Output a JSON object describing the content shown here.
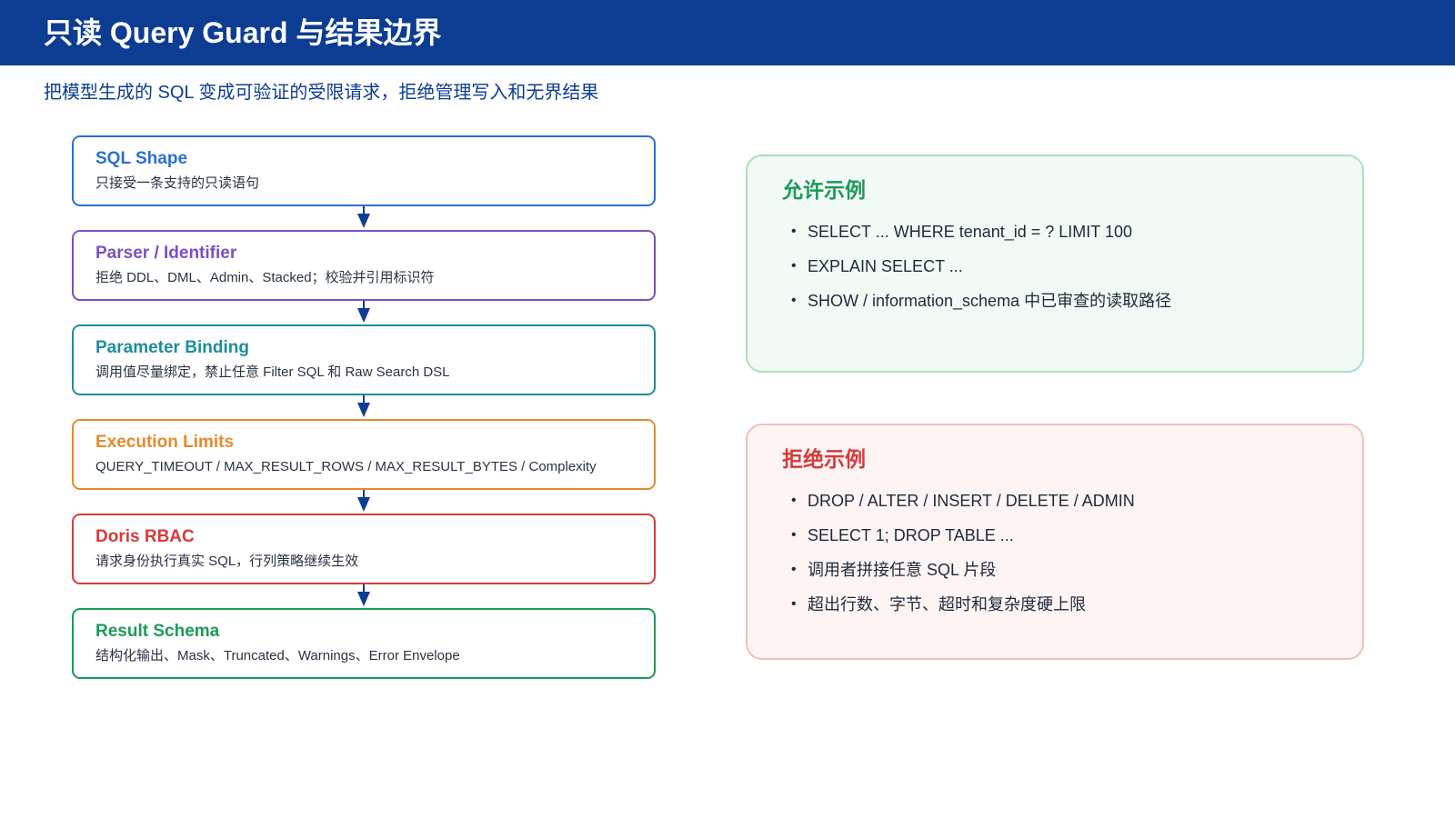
{
  "header": {
    "title": "只读 Query Guard 与结果边界",
    "subtitle": "把模型生成的 SQL 变成可验证的受限请求，拒绝管理写入和无界结果",
    "background": "#0d3d92"
  },
  "flow": {
    "steps": [
      {
        "title": "SQL Shape",
        "desc": "只接受一条支持的只读语句",
        "color": "#2a6fd6"
      },
      {
        "title": "Parser / Identifier",
        "desc": "拒绝 DDL、DML、Admin、Stacked；校验并引用标识符",
        "color": "#7b4fc4"
      },
      {
        "title": "Parameter Binding",
        "desc": "调用值尽量绑定，禁止任意 Filter SQL 和 Raw Search DSL",
        "color": "#1f8c9c"
      },
      {
        "title": "Execution Limits",
        "desc": "QUERY_TIMEOUT / MAX_RESULT_ROWS / MAX_RESULT_BYTES / Complexity",
        "color": "#e58a2c"
      },
      {
        "title": "Doris RBAC",
        "desc": "请求身份执行真实 SQL，行列策略继续生效",
        "color": "#d63b3b"
      },
      {
        "title": "Result Schema",
        "desc": "结构化输出、Mask、Truncated、Warnings、Error Envelope",
        "color": "#1c9a5a"
      }
    ],
    "arrow_color": "#0d3d92",
    "arrow_icon": "arrow-down-icon"
  },
  "allowed": {
    "title": "允许示例",
    "items": [
      "SELECT ... WHERE tenant_id = ? LIMIT 100",
      "EXPLAIN SELECT ...",
      "SHOW / information_schema 中已审查的读取路径"
    ],
    "title_color": "#1c9a5a",
    "border_color": "#a8dfc0",
    "background": "#f2faf5"
  },
  "rejected": {
    "title": "拒绝示例",
    "items": [
      "DROP / ALTER / INSERT / DELETE / ADMIN",
      "SELECT 1; DROP TABLE ...",
      "调用者拼接任意 SQL 片段",
      "超出行数、字节、超时和复杂度硬上限"
    ],
    "title_color": "#d63b3b",
    "border_color": "#eec0c0",
    "background": "#fdf4f3"
  },
  "bullet": "•"
}
